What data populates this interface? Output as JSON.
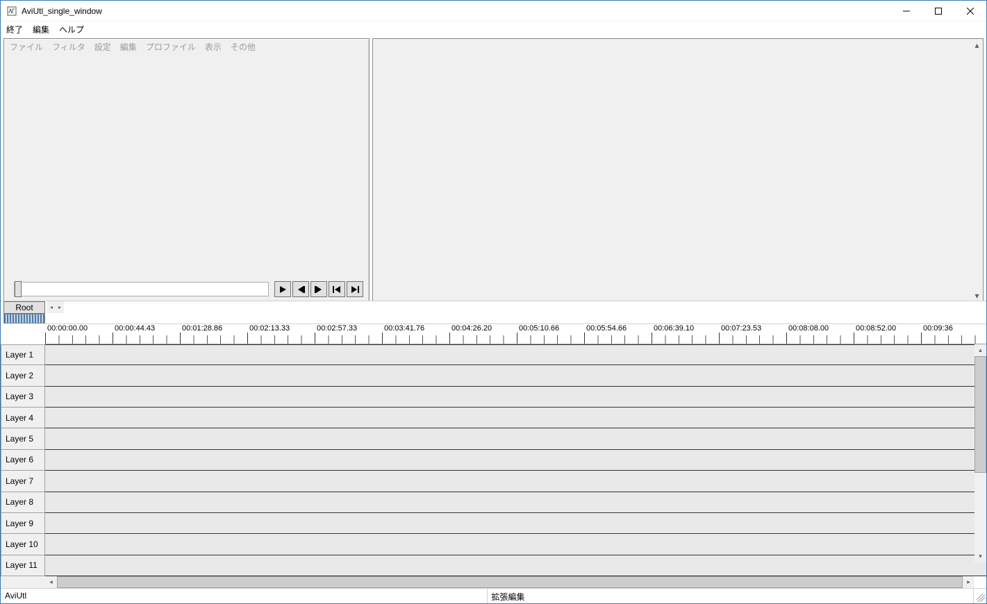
{
  "window": {
    "title": "AviUtl_single_window"
  },
  "mainmenu": {
    "items": [
      "終了",
      "編集",
      "ヘルプ"
    ]
  },
  "preview_menu": {
    "items": [
      "ファイル",
      "フィルタ",
      "設定",
      "編集",
      "プロファイル",
      "表示",
      "その他"
    ]
  },
  "transport": {
    "play": "play",
    "prev_frame": "prev-frame",
    "next_frame": "next-frame",
    "to_start": "to-start",
    "to_end": "to-end"
  },
  "timeline": {
    "root_label": "Root",
    "times": [
      "00:00:00.00",
      "00:00:44.43",
      "00:01:28.86",
      "00:02:13.33",
      "00:02:57.33",
      "00:03:41.76",
      "00:04:26.20",
      "00:05:10.66",
      "00:05:54.66",
      "00:06:39.10",
      "00:07:23.53",
      "00:08:08.00",
      "00:08:52.00",
      "00:09:36"
    ],
    "layers": [
      "Layer 1",
      "Layer 2",
      "Layer 3",
      "Layer 4",
      "Layer 5",
      "Layer 6",
      "Layer 7",
      "Layer 8",
      "Layer 9",
      "Layer 10",
      "Layer 11"
    ]
  },
  "status": {
    "left": "AviUtl",
    "right": "拡張編集"
  }
}
